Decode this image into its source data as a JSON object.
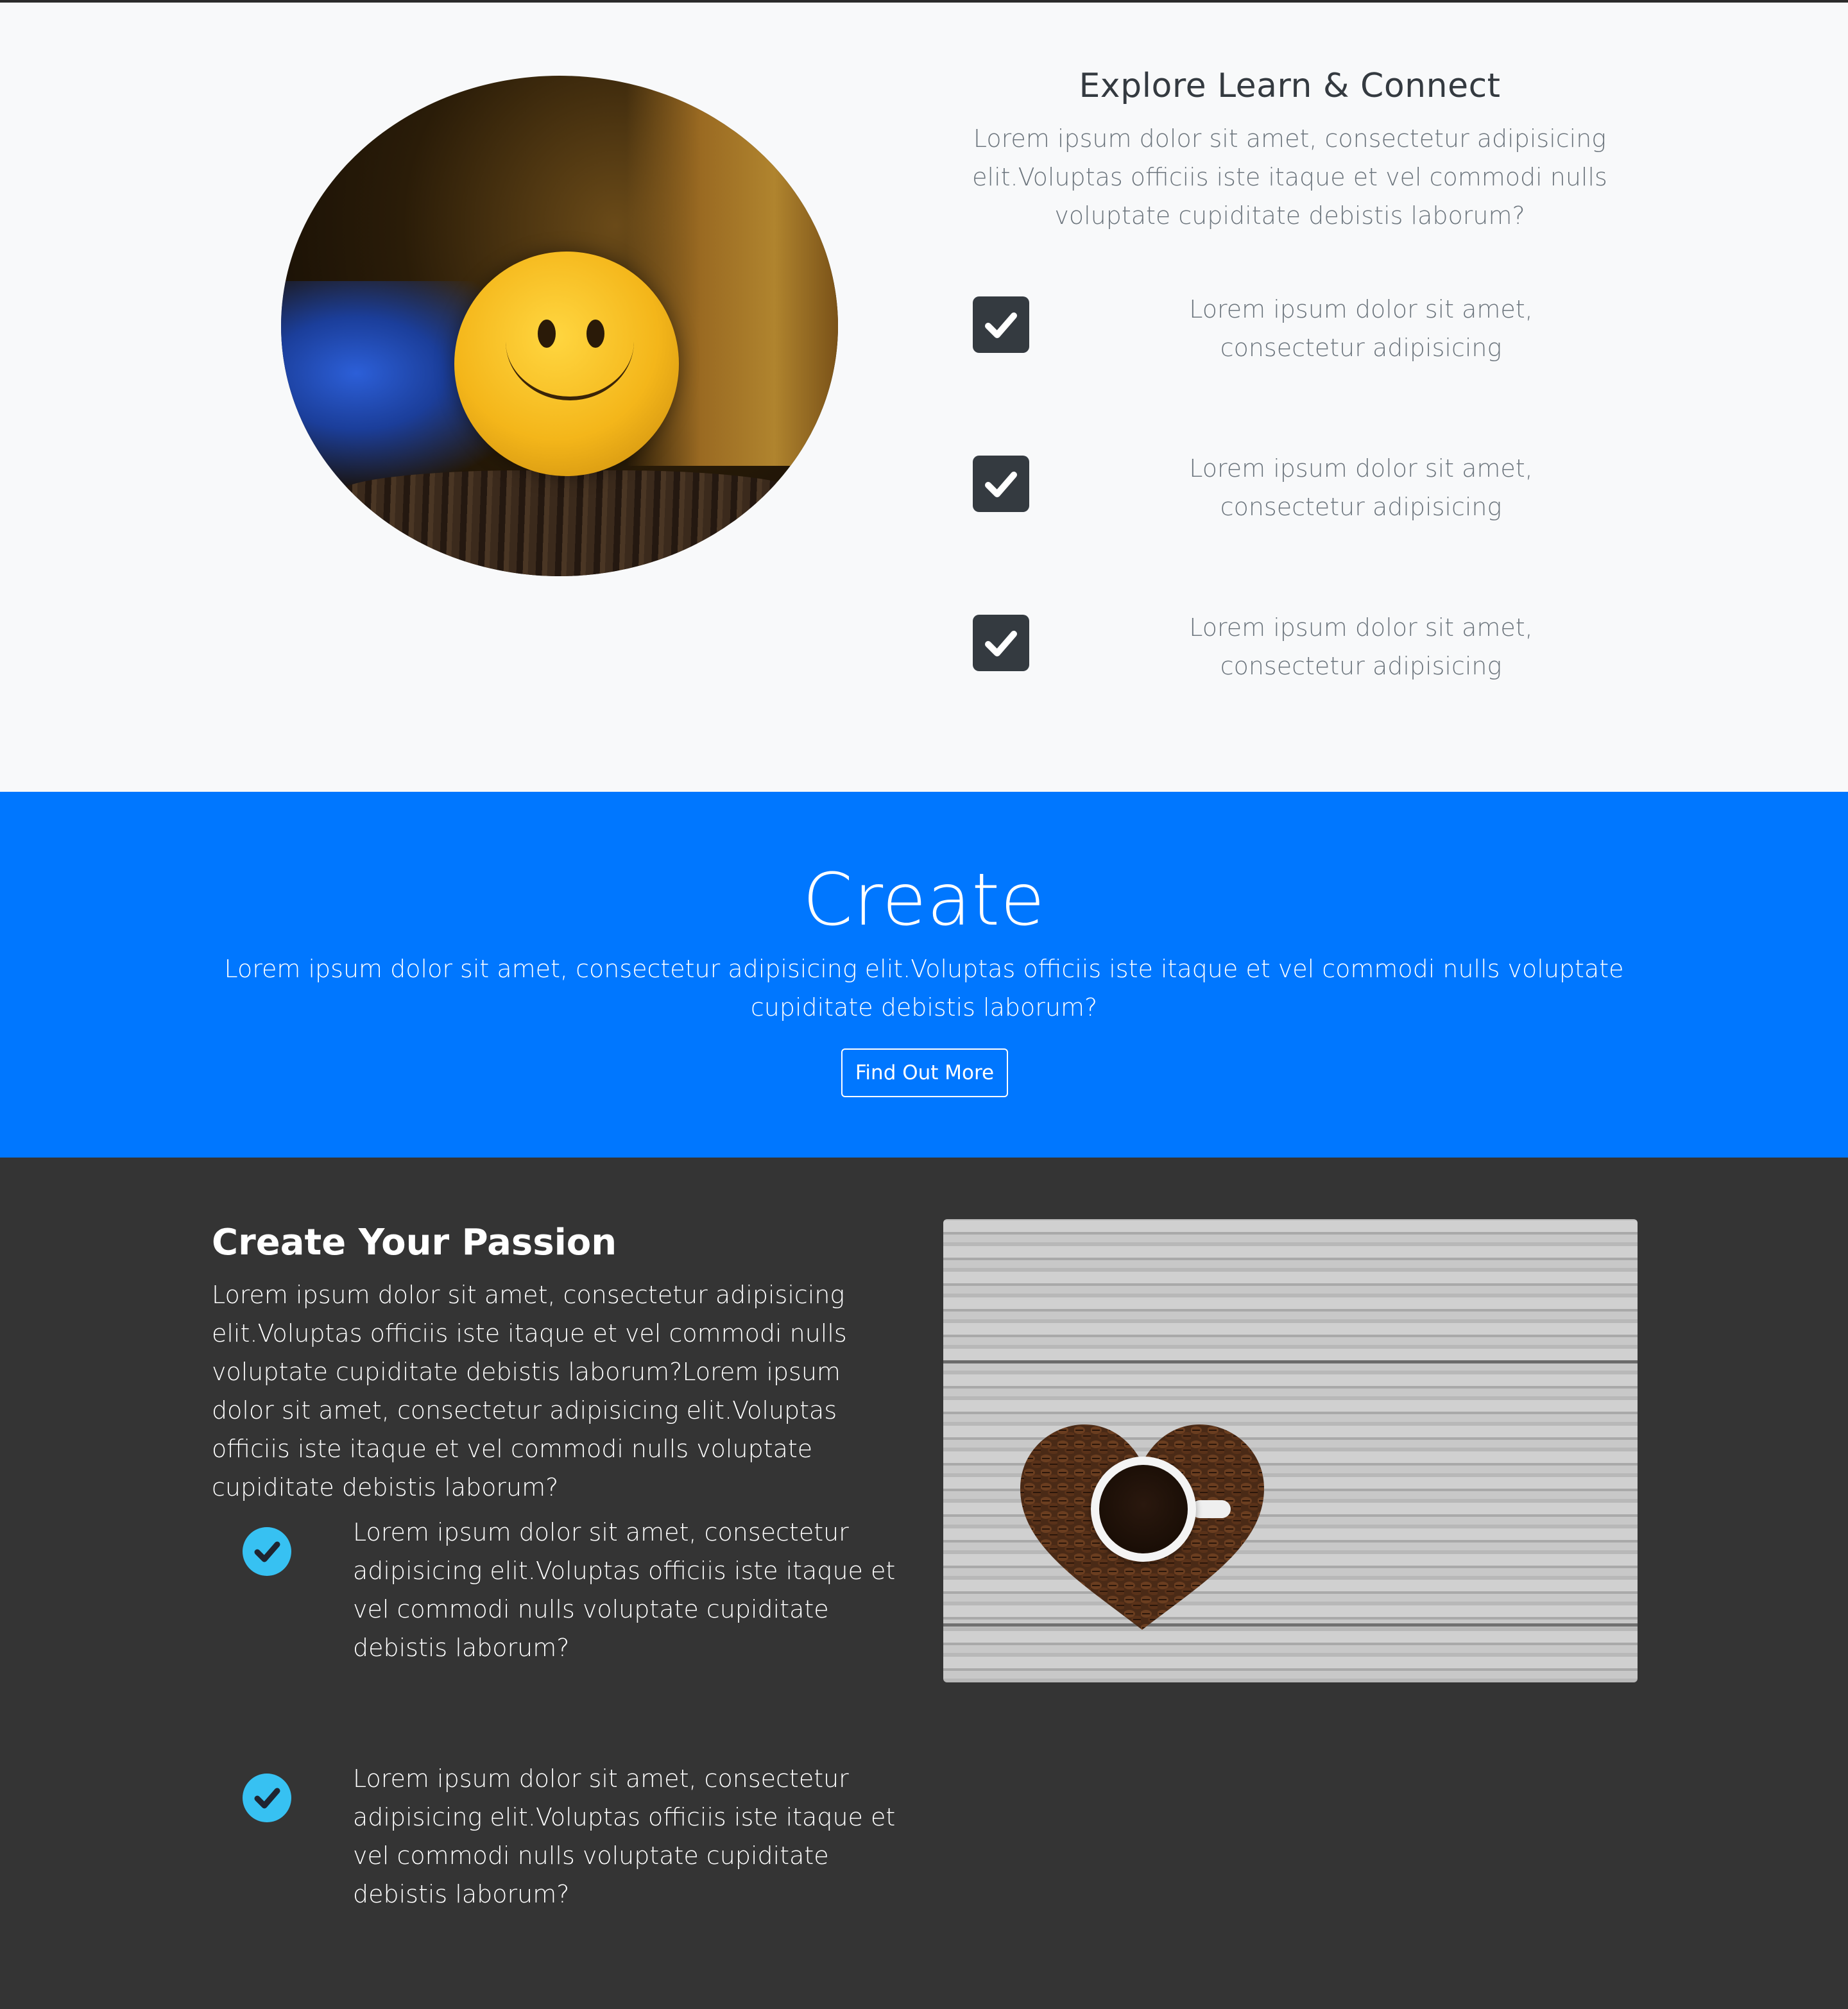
{
  "explore": {
    "title": "Explore Learn & Connect",
    "description": "Lorem ipsum dolor sit amet, consectetur adipisicing elit.Voluptas officiis iste itaque et vel commodi nulls voluptate cupiditate debistis laborum?",
    "items": [
      {
        "text": "Lorem ipsum dolor sit amet, consectetur adipisicing",
        "icon": "check-square-icon"
      },
      {
        "text": "Lorem ipsum dolor sit amet, consectetur adipisicing",
        "icon": "check-square-icon"
      },
      {
        "text": "Lorem ipsum dolor sit amet, consectetur adipisicing",
        "icon": "check-square-icon"
      }
    ],
    "image": "smiley-ball-photo"
  },
  "create": {
    "title": "Create",
    "description": "Lorem ipsum dolor sit amet, consectetur adipisicing elit.Voluptas officiis iste itaque et vel commodi nulls voluptate cupiditate debistis laborum?",
    "button_label": "Find Out More"
  },
  "passion": {
    "title": "Create Your Passion",
    "description": "Lorem ipsum dolor sit amet, consectetur adipisicing elit.Voluptas officiis iste itaque et vel commodi nulls voluptate cupiditate debistis laborum?Lorem ipsum dolor sit amet, consectetur adipisicing elit.Voluptas officiis iste itaque et vel commodi nulls voluptate cupiditate debistis laborum?",
    "items": [
      {
        "text": "Lorem ipsum dolor sit amet, consectetur adipisicing elit.Voluptas officiis iste itaque et vel commodi nulls voluptate cupiditate debistis laborum?",
        "icon": "check-circle-icon"
      },
      {
        "text": "Lorem ipsum dolor sit amet, consectetur adipisicing elit.Voluptas officiis iste itaque et vel commodi nulls voluptate cupiditate debistis laborum?",
        "icon": "check-circle-icon"
      }
    ],
    "image": "coffee-heart-photo"
  },
  "colors": {
    "light_bg": "#f8f9fa",
    "primary": "#0077ff",
    "dark_bg": "#343434",
    "check_square": "#343a40",
    "check_circle": "#37c1f2"
  }
}
